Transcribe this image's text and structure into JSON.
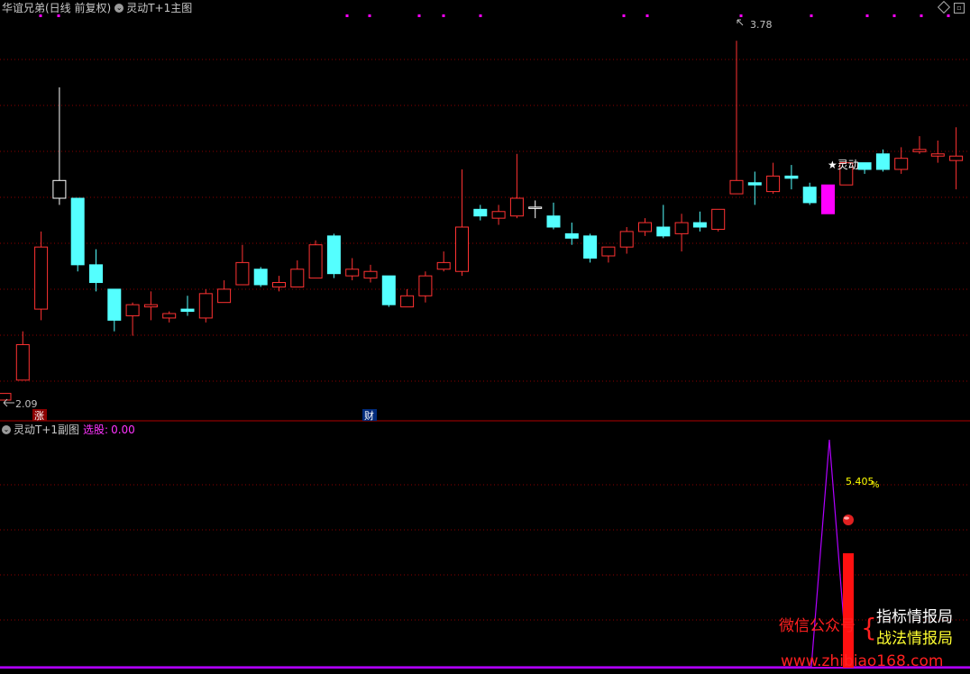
{
  "header": {
    "stock_title": "华谊兄弟(日线 前复权)",
    "main_indicator": "灵动T+1主图",
    "sub_indicator": "灵动T+1副图",
    "sub_label": "选股:",
    "sub_value": "0.00"
  },
  "main_chart": {
    "high_label": "3.78",
    "low_label": "2.09",
    "signal_label": "★灵动",
    "marker_zhang": "涨",
    "marker_cai": "财"
  },
  "sub_chart": {
    "percent_label": "5.405",
    "percent_sign": "%"
  },
  "watermark": {
    "wechat": "微信公众号",
    "brace": "{",
    "line1": "指标情报局",
    "line2": "战法情报局",
    "url": "www.zhibiao168.com"
  },
  "colors": {
    "up": "#ff3232",
    "down": "#54ffff",
    "signal": "#ff00ff",
    "grid": "#8b0000",
    "magenta_dot": "#ff00ff",
    "percent": "#ffff00"
  },
  "chart_data": {
    "type": "candlestick",
    "ylim": [
      2.09,
      3.78
    ],
    "series": [
      {
        "o": 2.09,
        "c": 2.12,
        "h": 2.12,
        "l": 2.09,
        "dir": "up"
      },
      {
        "o": 2.18,
        "c": 2.34,
        "h": 2.4,
        "l": 2.18,
        "dir": "up"
      },
      {
        "o": 2.5,
        "c": 2.78,
        "h": 2.85,
        "l": 2.45,
        "dir": "up"
      },
      {
        "o": 3.08,
        "c": 3.0,
        "h": 3.5,
        "l": 2.97,
        "dir": "none"
      },
      {
        "o": 3.0,
        "c": 2.7,
        "h": 2.73,
        "l": 2.67,
        "dir": "down"
      },
      {
        "o": 2.7,
        "c": 2.62,
        "h": 2.77,
        "l": 2.58,
        "dir": "down"
      },
      {
        "o": 2.59,
        "c": 2.45,
        "h": 2.59,
        "l": 2.4,
        "dir": "down"
      },
      {
        "o": 2.47,
        "c": 2.52,
        "h": 2.53,
        "l": 2.38,
        "dir": "up"
      },
      {
        "o": 2.51,
        "c": 2.52,
        "h": 2.58,
        "l": 2.45,
        "dir": "up"
      },
      {
        "o": 2.46,
        "c": 2.48,
        "h": 2.49,
        "l": 2.44,
        "dir": "up"
      },
      {
        "o": 2.5,
        "c": 2.49,
        "h": 2.56,
        "l": 2.47,
        "dir": "down"
      },
      {
        "o": 2.46,
        "c": 2.57,
        "h": 2.59,
        "l": 2.44,
        "dir": "up"
      },
      {
        "o": 2.53,
        "c": 2.59,
        "h": 2.63,
        "l": 2.53,
        "dir": "up"
      },
      {
        "o": 2.61,
        "c": 2.71,
        "h": 2.79,
        "l": 2.61,
        "dir": "up"
      },
      {
        "o": 2.68,
        "c": 2.61,
        "h": 2.69,
        "l": 2.6,
        "dir": "down"
      },
      {
        "o": 2.6,
        "c": 2.62,
        "h": 2.65,
        "l": 2.58,
        "dir": "up"
      },
      {
        "o": 2.6,
        "c": 2.68,
        "h": 2.72,
        "l": 2.6,
        "dir": "up"
      },
      {
        "o": 2.64,
        "c": 2.79,
        "h": 2.81,
        "l": 2.64,
        "dir": "up"
      },
      {
        "o": 2.83,
        "c": 2.66,
        "h": 2.84,
        "l": 2.64,
        "dir": "down"
      },
      {
        "o": 2.65,
        "c": 2.68,
        "h": 2.73,
        "l": 2.63,
        "dir": "up"
      },
      {
        "o": 2.64,
        "c": 2.67,
        "h": 2.7,
        "l": 2.62,
        "dir": "up"
      },
      {
        "o": 2.65,
        "c": 2.52,
        "h": 2.65,
        "l": 2.51,
        "dir": "down"
      },
      {
        "o": 2.51,
        "c": 2.56,
        "h": 2.59,
        "l": 2.51,
        "dir": "up"
      },
      {
        "o": 2.56,
        "c": 2.65,
        "h": 2.67,
        "l": 2.53,
        "dir": "up"
      },
      {
        "o": 2.68,
        "c": 2.71,
        "h": 2.76,
        "l": 2.67,
        "dir": "up"
      },
      {
        "o": 2.67,
        "c": 2.87,
        "h": 3.13,
        "l": 2.65,
        "dir": "up"
      },
      {
        "o": 2.95,
        "c": 2.92,
        "h": 2.97,
        "l": 2.9,
        "dir": "down"
      },
      {
        "o": 2.91,
        "c": 2.94,
        "h": 2.97,
        "l": 2.88,
        "dir": "up"
      },
      {
        "o": 2.92,
        "c": 3.0,
        "h": 3.2,
        "l": 2.91,
        "dir": "up"
      },
      {
        "o": 2.96,
        "c": 2.96,
        "h": 2.99,
        "l": 2.91,
        "dir": "none"
      },
      {
        "o": 2.92,
        "c": 2.87,
        "h": 2.98,
        "l": 2.86,
        "dir": "down"
      },
      {
        "o": 2.84,
        "c": 2.82,
        "h": 2.89,
        "l": 2.79,
        "dir": "down"
      },
      {
        "o": 2.83,
        "c": 2.73,
        "h": 2.84,
        "l": 2.71,
        "dir": "down"
      },
      {
        "o": 2.74,
        "c": 2.78,
        "h": 2.78,
        "l": 2.71,
        "dir": "up"
      },
      {
        "o": 2.78,
        "c": 2.85,
        "h": 2.87,
        "l": 2.75,
        "dir": "up"
      },
      {
        "o": 2.85,
        "c": 2.89,
        "h": 2.91,
        "l": 2.83,
        "dir": "up"
      },
      {
        "o": 2.87,
        "c": 2.83,
        "h": 2.97,
        "l": 2.82,
        "dir": "down"
      },
      {
        "o": 2.84,
        "c": 2.89,
        "h": 2.93,
        "l": 2.76,
        "dir": "up"
      },
      {
        "o": 2.89,
        "c": 2.87,
        "h": 2.94,
        "l": 2.85,
        "dir": "down"
      },
      {
        "o": 2.86,
        "c": 2.95,
        "h": 2.95,
        "l": 2.85,
        "dir": "up"
      },
      {
        "o": 3.02,
        "c": 3.08,
        "h": 3.71,
        "l": 3.02,
        "dir": "up"
      },
      {
        "o": 3.07,
        "c": 3.06,
        "h": 3.12,
        "l": 2.97,
        "dir": "down"
      },
      {
        "o": 3.03,
        "c": 3.1,
        "h": 3.16,
        "l": 3.02,
        "dir": "up"
      },
      {
        "o": 3.1,
        "c": 3.09,
        "h": 3.15,
        "l": 3.04,
        "dir": "down"
      },
      {
        "o": 3.05,
        "c": 2.98,
        "h": 3.07,
        "l": 2.97,
        "dir": "down"
      },
      {
        "o": 3.06,
        "c": 2.93,
        "h": 3.06,
        "l": 2.93,
        "dir": "signal"
      },
      {
        "o": 3.06,
        "c": 3.16,
        "h": 3.16,
        "l": 3.06,
        "dir": "up"
      },
      {
        "o": 3.16,
        "c": 3.13,
        "h": 3.16,
        "l": 3.11,
        "dir": "down"
      },
      {
        "o": 3.2,
        "c": 3.13,
        "h": 3.22,
        "l": 3.12,
        "dir": "down"
      },
      {
        "o": 3.13,
        "c": 3.18,
        "h": 3.23,
        "l": 3.11,
        "dir": "up"
      },
      {
        "o": 3.21,
        "c": 3.22,
        "h": 3.28,
        "l": 3.2,
        "dir": "up"
      },
      {
        "o": 3.19,
        "c": 3.2,
        "h": 3.26,
        "l": 3.16,
        "dir": "up"
      },
      {
        "o": 3.19,
        "c": 3.17,
        "h": 3.32,
        "l": 3.04,
        "dir": "up"
      }
    ],
    "sub_series": {
      "spike_peak": 100,
      "red_bar_value": 60
    }
  }
}
